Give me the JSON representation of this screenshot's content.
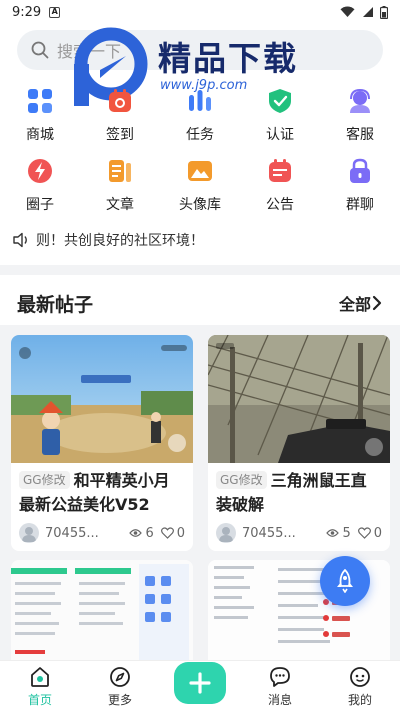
{
  "status_bar": {
    "time": "9:29",
    "badge": "A"
  },
  "search": {
    "placeholder": "搜索一下"
  },
  "watermark": {
    "title": "精品下载",
    "url": "www.j9p.com"
  },
  "grid": {
    "row1": [
      {
        "label": "商城",
        "icon": "apps-icon",
        "color": "#3e7bf7"
      },
      {
        "label": "签到",
        "icon": "calendar-check-icon",
        "color": "#f1553f"
      },
      {
        "label": "任务",
        "icon": "task-bars-icon",
        "color": "#3e7bf7"
      },
      {
        "label": "认证",
        "icon": "shield-check-icon",
        "color": "#22c17e"
      },
      {
        "label": "客服",
        "icon": "customer-service-icon",
        "color": "#7b6cf6"
      }
    ],
    "row2": [
      {
        "label": "圈子",
        "icon": "lightning-circle-icon",
        "color": "#f05454"
      },
      {
        "label": "文章",
        "icon": "article-icon",
        "color": "#f39a2c"
      },
      {
        "label": "头像库",
        "icon": "mountain-image-icon",
        "color": "#f39a2c"
      },
      {
        "label": "公告",
        "icon": "calendar-notice-icon",
        "color": "#f05454"
      },
      {
        "label": "群聊",
        "icon": "lock-group-icon",
        "color": "#7b6cf6"
      }
    ]
  },
  "notice": {
    "text": "则！共创良好的社区环境！"
  },
  "section": {
    "title": "最新帖子",
    "more": "全部"
  },
  "posts": [
    {
      "tag": "GG修改",
      "title": "和平精英小月最新公益美化V52",
      "author": "70455...",
      "views": "6",
      "likes": "0"
    },
    {
      "tag": "GG修改",
      "title": "三角洲鼠王直装破解",
      "author": "70455...",
      "views": "5",
      "likes": "0"
    }
  ],
  "nav": {
    "items": [
      {
        "label": "首页"
      },
      {
        "label": "更多"
      },
      {
        "label": "消息"
      },
      {
        "label": "我的"
      }
    ]
  },
  "colors": {
    "accent": "#1fc2a0",
    "fab": "#3d7cf3"
  }
}
